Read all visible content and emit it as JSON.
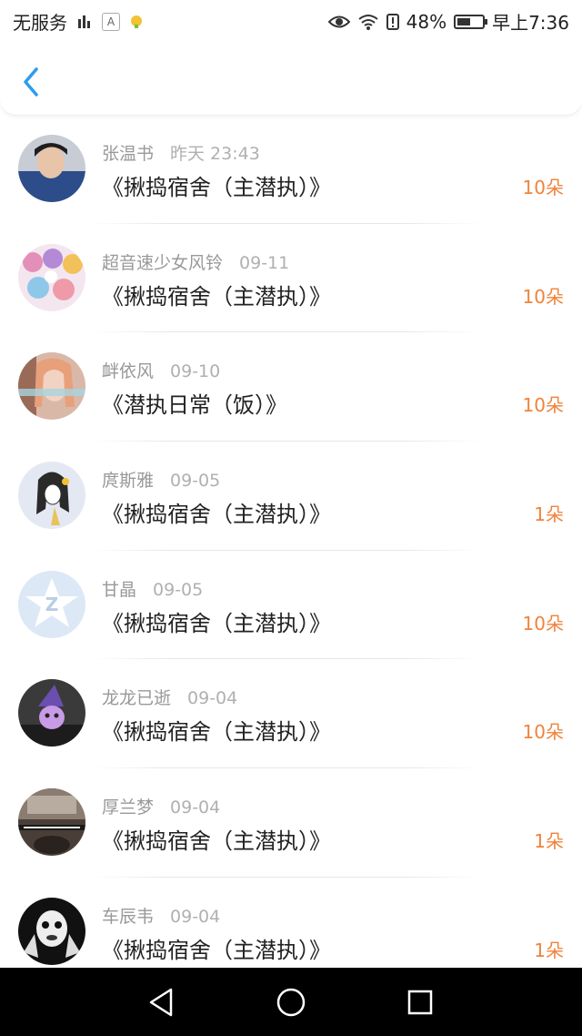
{
  "status_bar": {
    "carrier": "无服务",
    "notif_a": "A",
    "battery": "48%",
    "time": "早上7:36"
  },
  "colors": {
    "accent_blue": "#2c9cf0",
    "amount_orange": "#f0833a"
  },
  "list": [
    {
      "name": "张温书",
      "time": "昨天 23:43",
      "title": "《揪捣宿舍（主潜执）》",
      "amount": "10朵"
    },
    {
      "name": "超音速少女风铃",
      "time": "09-11",
      "title": "《揪捣宿舍（主潜执）》",
      "amount": "10朵"
    },
    {
      "name": "衅依风",
      "time": "09-10",
      "title": "《潜执日常（饭）》",
      "amount": "10朵"
    },
    {
      "name": "庹斯雅",
      "time": "09-05",
      "title": "《揪捣宿舍（主潜执）》",
      "amount": "1朵"
    },
    {
      "name": "甘晶",
      "time": "09-05",
      "title": "《揪捣宿舍（主潜执）》",
      "amount": "10朵"
    },
    {
      "name": "龙龙已逝",
      "time": "09-04",
      "title": "《揪捣宿舍（主潜执）》",
      "amount": "10朵"
    },
    {
      "name": "厚兰梦",
      "time": "09-04",
      "title": "《揪捣宿舍（主潜执）》",
      "amount": "1朵"
    },
    {
      "name": "车辰韦",
      "time": "09-04",
      "title": "《揪捣宿舍（主潜执）》",
      "amount": "1朵"
    }
  ],
  "icons": {
    "back": "chevron-left-icon",
    "nav_back": "triangle-back-icon",
    "nav_home": "circle-home-icon",
    "nav_recent": "square-recent-icon"
  }
}
